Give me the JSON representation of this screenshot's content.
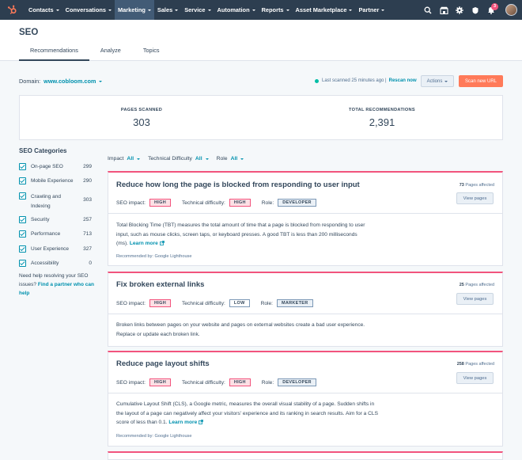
{
  "nav": {
    "items": [
      {
        "label": "Contacts"
      },
      {
        "label": "Conversations"
      },
      {
        "label": "Marketing",
        "active": true
      },
      {
        "label": "Sales"
      },
      {
        "label": "Service"
      },
      {
        "label": "Automation"
      },
      {
        "label": "Reports"
      },
      {
        "label": "Asset Marketplace"
      },
      {
        "label": "Partner"
      }
    ],
    "icons": [
      "search-icon",
      "marketplace-icon",
      "settings-gear-icon",
      "help-icon",
      "notifications-bell-icon"
    ],
    "notification_count": "3"
  },
  "header": {
    "title": "SEO",
    "tabs": [
      "Recommendations",
      "Analyze",
      "Topics"
    ],
    "active_tab": "Recommendations"
  },
  "domain": {
    "label": "Domain:",
    "value": "www.cobloom.com"
  },
  "scan": {
    "last_scanned": "Last scanned 25 minutes ago |",
    "rescan_label": "Rescan now",
    "actions_label": "Actions",
    "scan_new_label": "Scan new URL"
  },
  "stats": {
    "pages_scanned_label": "PAGES SCANNED",
    "pages_scanned_value": "303",
    "total_recs_label": "TOTAL RECOMMENDATIONS",
    "total_recs_value": "2,391"
  },
  "categories": {
    "title": "SEO Categories",
    "items": [
      {
        "label": "On-page SEO",
        "count": "299"
      },
      {
        "label": "Mobile Experience",
        "count": "290"
      },
      {
        "label": "Crawling and Indexing",
        "count": "303"
      },
      {
        "label": "Security",
        "count": "257"
      },
      {
        "label": "Performance",
        "count": "713"
      },
      {
        "label": "User Experience",
        "count": "327"
      },
      {
        "label": "Accessibility",
        "count": "0"
      }
    ],
    "help_text": "Need help resolving your SEO issues?",
    "help_link": "Find a partner who can help"
  },
  "filters": [
    {
      "label": "Impact",
      "value": "All"
    },
    {
      "label": "Technical Difficulty",
      "value": "All"
    },
    {
      "label": "Role",
      "value": "All"
    }
  ],
  "labels": {
    "seo_impact": "SEO impact:",
    "tech_difficulty": "Technical difficulty:",
    "role": "Role:",
    "view_pages": "View pages",
    "pages_affected_suffix": "Pages affected",
    "learn_more": "Learn more"
  },
  "recommendations": [
    {
      "title": "Reduce how long the page is blocked from responding to user input",
      "pages_affected": "73",
      "impact": "HIGH",
      "difficulty": "HIGH",
      "role": "DEVELOPER",
      "description": "Total Blocking Time (TBT) measures the total amount of time that a page is blocked from responding to user input, such as mouse clicks, screen taps, or keyboard presses. A good TBT is less than 200 milliseconds (ms).",
      "recommended_by": "Recommended by: Google Lighthouse"
    },
    {
      "title": "Fix broken external links",
      "pages_affected": "25",
      "impact": "HIGH",
      "difficulty": "LOW",
      "role": "MARKETER",
      "description": "Broken links between pages on your website and pages on external websites create a bad user experience. Replace or update each broken link."
    },
    {
      "title": "Reduce page layout shifts",
      "pages_affected": "258",
      "impact": "HIGH",
      "difficulty": "HIGH",
      "role": "DEVELOPER",
      "description": "Cumulative Layout Shift (CLS), a Google metric, measures the overall visual stability of a page. Sudden shifts in the layout of a page can negatively affect your visitors' experience and its ranking in search results. Aim for a CLS score of less than 0.1.",
      "recommended_by": "Recommended by: Google Lighthouse"
    }
  ],
  "colors": {
    "nav_bg": "#2d3e50",
    "accent_link": "#0091ae",
    "cta_orange": "#ff7a59",
    "card_border_pink": "#f2547d"
  }
}
